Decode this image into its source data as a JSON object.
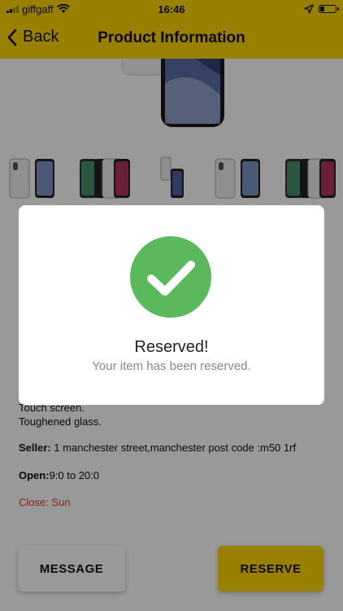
{
  "status_bar": {
    "carrier": "giffgaff",
    "time": "16:46"
  },
  "nav": {
    "back_label": "Back",
    "title": "Product Information"
  },
  "product": {
    "description_lines": [
      "Touch screen.",
      "Toughened glass."
    ],
    "seller_label": "Seller:",
    "seller_value": " 1 manchester street,manchester post code :m50 1rf",
    "open_label": "Open:",
    "open_value": "9:0 to 20:0",
    "close_text": "Close: Sun"
  },
  "actions": {
    "message_label": "MESSAGE",
    "reserve_label": "RESERVE"
  },
  "modal": {
    "title": "Reserved!",
    "subtitle": "Your item has been reserved."
  },
  "colors": {
    "accent": "#FFD500",
    "success": "#5CB85C",
    "close_red": "#e53935"
  }
}
